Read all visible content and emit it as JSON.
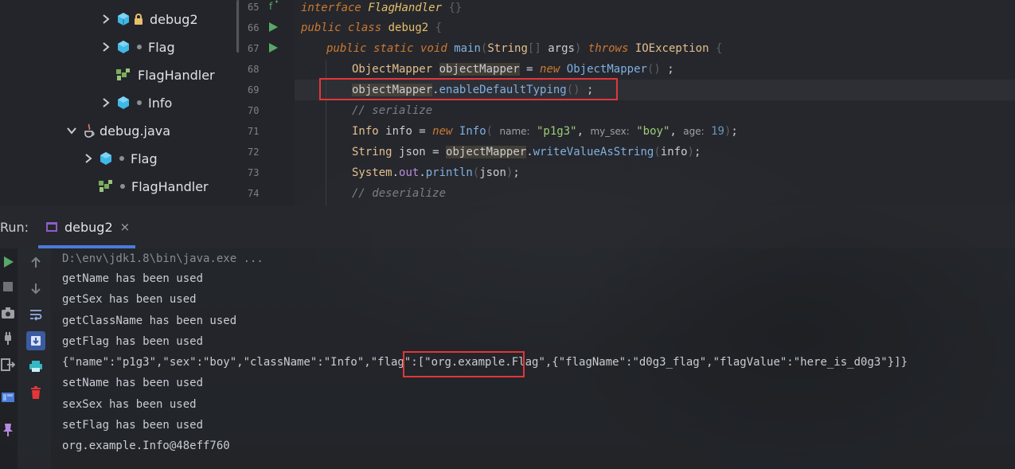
{
  "project_tree": {
    "items": [
      {
        "label": "debug2",
        "icon": "class-cube-icon",
        "badge": "lock-icon"
      },
      {
        "label": "Flag",
        "icon": "class-cube-icon",
        "badge": "dot"
      },
      {
        "label": "FlagHandler",
        "icon": "enum-icon"
      },
      {
        "label": "Info",
        "icon": "class-cube-icon",
        "badge": "dot"
      },
      {
        "label": "debug.java",
        "icon": "java-file-icon"
      },
      {
        "label": "Flag",
        "icon": "class-cube-icon",
        "badge": "dot"
      },
      {
        "label": "FlagHandler",
        "icon": "enum-icon",
        "badge": "dot"
      }
    ]
  },
  "editor": {
    "line_numbers": [
      "65",
      "66",
      "67",
      "68",
      "69",
      "70",
      "71",
      "72",
      "73",
      "74"
    ],
    "code": {
      "l65": {
        "kw": "interface",
        "name": "FlagHandler"
      },
      "l66": {
        "kw1": "public",
        "kw2": "class",
        "name": "debug2"
      },
      "l67": {
        "kw1": "public",
        "kw2": "static",
        "kw3": "void",
        "name": "main",
        "type": "String",
        "param": "args",
        "throws": "throws",
        "exc": "IOException"
      },
      "l68": {
        "type": "ObjectMapper",
        "var": "objectMapper",
        "eq": " = ",
        "kw": "new",
        "ctor": "ObjectMapper",
        "end": ";"
      },
      "l69": {
        "var": "objectMapper",
        "dot": ".",
        "method": "enableDefaultTyping",
        "end": ";"
      },
      "l70": {
        "comment": "// serialize"
      },
      "l71": {
        "type": "Info",
        "var": "info",
        "eq": " = ",
        "kw": "new",
        "ctor": "Info",
        "hint1": "name:",
        "arg1": "\"p1g3\"",
        "hint2": "my_sex:",
        "arg2": "\"boy\"",
        "hint3": "age:",
        "arg3": "19",
        "end": ";"
      },
      "l72": {
        "type": "String",
        "var": "json",
        "eq": " = ",
        "obj": "objectMapper",
        "dot": ".",
        "method": "writeValueAsString",
        "arg": "info",
        "end": ";"
      },
      "l73": {
        "cls": "System",
        "dot1": ".",
        "field": "out",
        "dot2": ".",
        "method": "println",
        "arg": "json",
        "end": ";"
      },
      "l74": {
        "comment": "// deserialize"
      }
    }
  },
  "run_panel": {
    "label": "Run:",
    "tab_label": "debug2",
    "close_glyph": "×"
  },
  "console": {
    "path_line": "D:\\env\\jdk1.8\\bin\\java.exe ...",
    "lines": [
      "getName has been used",
      "getSex has been used",
      "getClassName has been used",
      "getFlag has been used"
    ],
    "json_before": "{\"name\":\"p1g3\",\"sex\":\"boy\",\"className\":\"Info\",\"flag\":[",
    "json_highlight": "\"org.example.Flag\"",
    "json_after": ",{\"flagName\":\"d0g3_flag\",\"flagValue\":\"here_is_d0g3\"}]}",
    "lines_after": [
      "setName has been used",
      "sexSex has been used",
      "setFlag has been used",
      "org.example.Info@48eff760"
    ]
  },
  "colors": {
    "highlight_box": "#e2363b",
    "run_green": "#59a869",
    "tab_underline": "#4b7bd9",
    "class_icon": "#3fb8e6"
  }
}
